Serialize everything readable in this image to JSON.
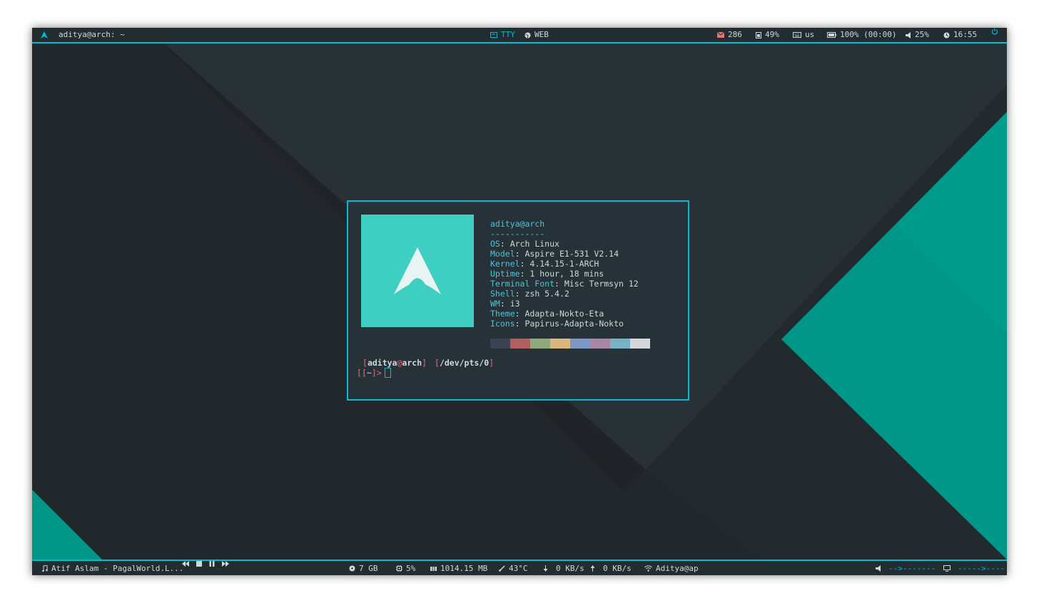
{
  "colors": {
    "accent": "#00bcd4",
    "bar_bg": "#222d32",
    "teal": "#009688",
    "mail": "#e57373"
  },
  "top_bar": {
    "window_title": "aditya@arch: ~",
    "workspaces": [
      {
        "label": "TTY",
        "active": true
      },
      {
        "label": "WEB",
        "active": false
      }
    ],
    "mail_count": "286",
    "memory": "49%",
    "keyboard_layout": "us",
    "battery": "100% (00:00)",
    "volume": "25%",
    "clock": "16:55"
  },
  "neofetch": {
    "header": "aditya@arch",
    "separator": "-----------",
    "fields": [
      {
        "key": "OS",
        "value": "Arch Linux"
      },
      {
        "key": "Model",
        "value": "Aspire E1-531 V2.14"
      },
      {
        "key": "Kernel",
        "value": "4.14.15-1-ARCH"
      },
      {
        "key": "Uptime",
        "value": "1 hour, 18 mins"
      },
      {
        "key": "Terminal Font",
        "value": "Misc Termsyn 12"
      },
      {
        "key": "Shell",
        "value": "zsh 5.4.2"
      },
      {
        "key": "WM",
        "value": "i3"
      },
      {
        "key": "Theme",
        "value": "Adapta-Nokto-Eta"
      },
      {
        "key": "Icons",
        "value": "Papirus-Adapta-Nokto"
      }
    ],
    "palette": [
      "#3b4252",
      "#b35f5f",
      "#90aa7c",
      "#d9b77e",
      "#7d98c4",
      "#a886a6",
      "#79b2c2",
      "#d4d7da"
    ]
  },
  "prompt": {
    "user": "aditya",
    "at": "@",
    "host": "arch",
    "tty": "/dev/pts/0",
    "cwd": "~"
  },
  "bottom_bar": {
    "now_playing": "Atif Aslam - PagalWorld.L...",
    "disk": "7 GB",
    "cpu": "5%",
    "ram": "1014.15 MB",
    "temperature": "43°C",
    "net_down": "0 KB/s",
    "net_up": "0 KB/s",
    "wifi": "Aditya@ap",
    "volume_bar": "-->-------",
    "brightness_bar": "----->----"
  }
}
